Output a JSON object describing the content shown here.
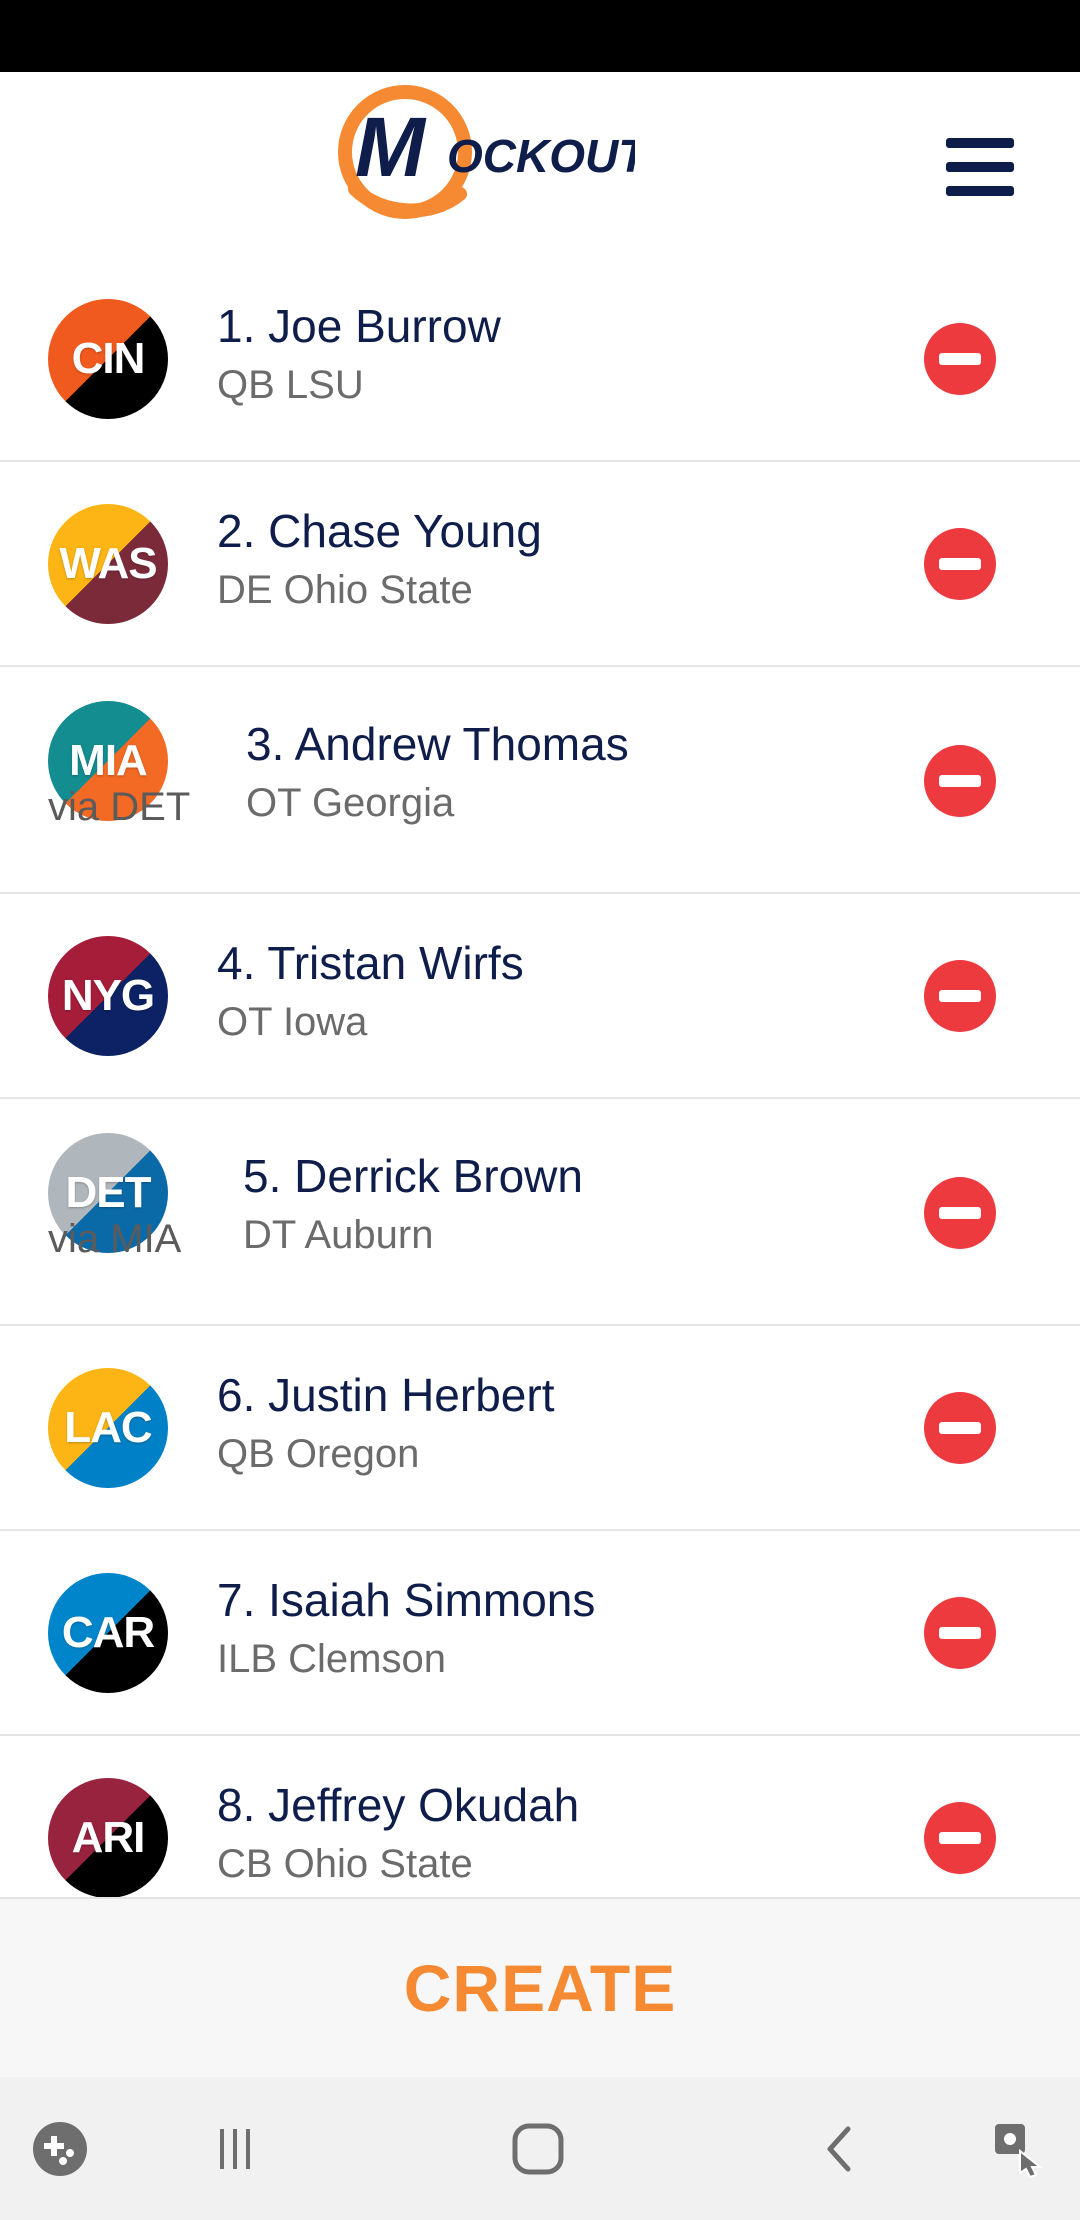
{
  "app": {
    "logo_text": "Mockout"
  },
  "picks": [
    {
      "team": "CIN",
      "name": "1. Joe Burrow",
      "detail": "QB LSU",
      "via": "",
      "colors": [
        "#f05a1e",
        "#000000"
      ]
    },
    {
      "team": "WAS",
      "name": "2. Chase Young",
      "detail": "DE Ohio State",
      "via": "",
      "colors": [
        "#fcb514",
        "#7b2a3a"
      ]
    },
    {
      "team": "MIA",
      "name": "3. Andrew Thomas",
      "detail": "OT Georgia",
      "via": "via DET",
      "colors": [
        "#138d90",
        "#f26a24"
      ]
    },
    {
      "team": "NYG",
      "name": "4. Tristan Wirfs",
      "detail": "OT Iowa",
      "via": "",
      "colors": [
        "#a61d3a",
        "#0c2265"
      ]
    },
    {
      "team": "DET",
      "name": "5. Derrick Brown",
      "detail": "DT Auburn",
      "via": "via MIA",
      "colors": [
        "#b0b7bc",
        "#0a6aa8"
      ]
    },
    {
      "team": "LAC",
      "name": "6. Justin Herbert",
      "detail": "QB Oregon",
      "via": "",
      "colors": [
        "#fcb514",
        "#0080c6"
      ]
    },
    {
      "team": "CAR",
      "name": "7. Isaiah Simmons",
      "detail": "ILB Clemson",
      "via": "",
      "colors": [
        "#0085ca",
        "#000000"
      ]
    },
    {
      "team": "ARI",
      "name": "8. Jeffrey Okudah",
      "detail": "CB Ohio State",
      "via": "",
      "colors": [
        "#97233f",
        "#000000"
      ]
    }
  ],
  "footer": {
    "create_label": "CREATE"
  },
  "nav": {
    "icons": [
      "game-launcher-icon",
      "recent-apps-icon",
      "home-icon",
      "back-icon",
      "accessibility-icon"
    ]
  },
  "colors": {
    "navy": "#0f1d4a",
    "orange": "#f58a32",
    "remove_red": "#ec3a3f"
  }
}
